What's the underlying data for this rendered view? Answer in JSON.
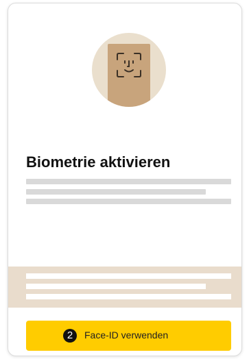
{
  "icons": {
    "hero": "face-id-icon"
  },
  "colors": {
    "accent": "#ffcc00",
    "avatar_bg": "#eadfcd",
    "phone": "#c8a47c",
    "band": "#e9dccc"
  },
  "main": {
    "title": "Biometrie aktivieren"
  },
  "cta": {
    "step_number": "2",
    "label": "Face-ID verwenden"
  }
}
